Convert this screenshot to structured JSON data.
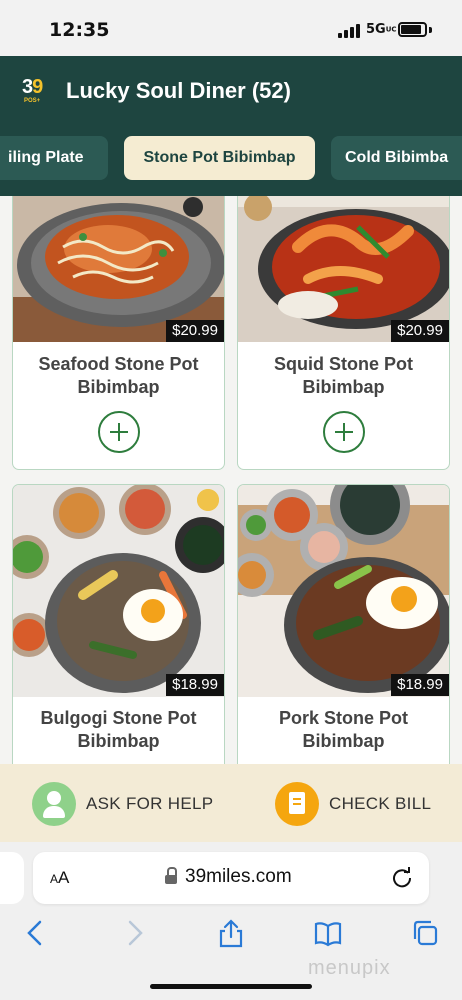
{
  "status_bar": {
    "time": "12:35",
    "network": "5G",
    "network_suffix": "UC"
  },
  "header": {
    "logo_number_a": "3",
    "logo_number_b": "9",
    "logo_sub": "POS+",
    "restaurant_name": "Lucky Soul Diner (52)"
  },
  "categories": [
    {
      "label": "iling Plate",
      "selected": false
    },
    {
      "label": "Stone Pot Bibimbap",
      "selected": true
    },
    {
      "label": "Cold Bibimba",
      "selected": false
    }
  ],
  "menu_items": [
    {
      "name": "Seafood Stone Pot Bibimbap",
      "price": "$20.99",
      "add_icon": "plus-circle-icon"
    },
    {
      "name": "Squid Stone Pot Bibimbap",
      "price": "$20.99",
      "add_icon": "plus-circle-icon"
    },
    {
      "name": "Bulgogi Stone Pot Bibimbap",
      "price": "$18.99",
      "badge_icon": "thumbs-up-icon"
    },
    {
      "name": "Pork Stone Pot Bibimbap",
      "price": "$18.99"
    }
  ],
  "actions": {
    "help_label": "ASK FOR HELP",
    "bill_label": "CHECK BILL"
  },
  "browser": {
    "aa_small": "A",
    "aa_large": "A",
    "url": "39miles.com"
  },
  "watermark": "menupix",
  "colors": {
    "header_bg": "#1e4540",
    "tab_bg": "#2c5a54",
    "tab_selected_bg": "#f5ecd2",
    "accent_green": "#2e7d3d",
    "action_bar_bg": "#f3ebd6",
    "help_icon": "#8fd18a",
    "bill_icon": "#f5a60f"
  }
}
